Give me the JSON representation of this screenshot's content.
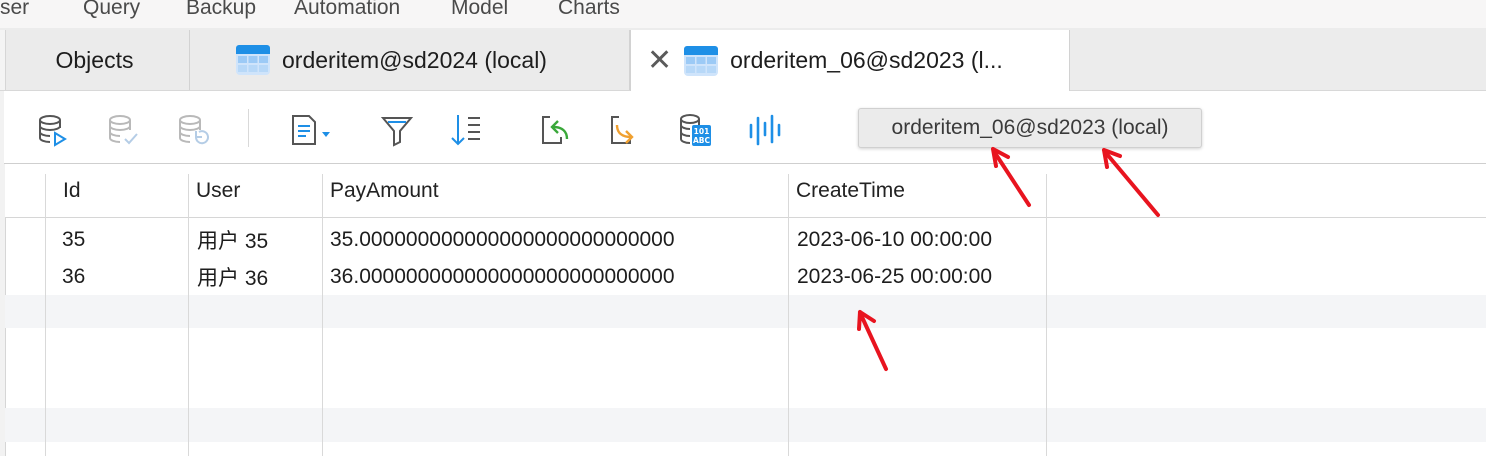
{
  "menubar": {
    "items": [
      "ser",
      "Query",
      "Backup",
      "Automation",
      "Model",
      "Charts"
    ]
  },
  "tabs": [
    {
      "label": "Objects"
    },
    {
      "label": "orderitem@sd2024 (local)"
    },
    {
      "label": "orderitem_06@sd2023 (l..."
    }
  ],
  "tooltip": {
    "text": "orderitem_06@sd2023 (local)"
  },
  "toolbar": {
    "icons": [
      "run-query-icon",
      "commit-icon",
      "rollback-icon",
      "text-format-icon",
      "filter-icon",
      "sort-icon",
      "import-icon",
      "export-icon",
      "data-generation-icon",
      "chart-icon"
    ]
  },
  "grid": {
    "columns": [
      "Id",
      "User",
      "PayAmount",
      "CreateTime"
    ],
    "rows": [
      [
        "35",
        "用户 35",
        "35.000000000000000000000000000",
        "2023-06-10 00:00:00"
      ],
      [
        "36",
        "用户 36",
        "36.000000000000000000000000000",
        "2023-06-25 00:00:00"
      ]
    ]
  },
  "colors": {
    "annotation_arrow": "#e8141f",
    "accent": "#1e8fe6",
    "row_alt": "#f4f5f7"
  }
}
